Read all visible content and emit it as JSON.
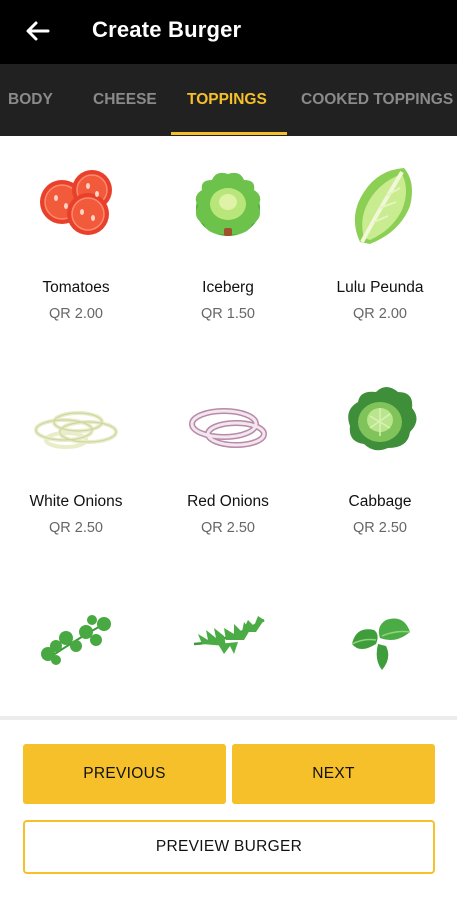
{
  "header": {
    "title": "Create Burger",
    "back_icon": "arrow-left-icon"
  },
  "tabs": [
    {
      "label": "BODY",
      "active": false
    },
    {
      "label": "CHEESE",
      "active": false
    },
    {
      "label": "TOPPINGS",
      "active": true
    },
    {
      "label": "COOKED TOPPINGS",
      "active": false
    }
  ],
  "items": [
    {
      "name": "Tomatoes",
      "price": "QR 2.00",
      "icon": "tomato-slices-icon"
    },
    {
      "name": "Iceberg",
      "price": "QR 1.50",
      "icon": "iceberg-lettuce-icon"
    },
    {
      "name": "Lulu Peunda",
      "price": "QR 2.00",
      "icon": "lettuce-leaf-icon"
    },
    {
      "name": "White Onions",
      "price": "QR 2.50",
      "icon": "white-onion-rings-icon"
    },
    {
      "name": "Red Onions",
      "price": "QR 2.50",
      "icon": "red-onion-rings-icon"
    },
    {
      "name": "Cabbage",
      "price": "QR 2.50",
      "icon": "cabbage-icon"
    },
    {
      "icon": "parsley-icon"
    },
    {
      "icon": "arugula-icon"
    },
    {
      "icon": "basil-leaves-icon"
    }
  ],
  "buttons": {
    "previous": "PREVIOUS",
    "next": "NEXT",
    "preview": "PREVIEW BURGER"
  },
  "colors": {
    "accent": "#f5c02a",
    "header_bg": "#000000",
    "tabs_bg": "#212121",
    "tab_inactive": "#8a8a8a"
  }
}
